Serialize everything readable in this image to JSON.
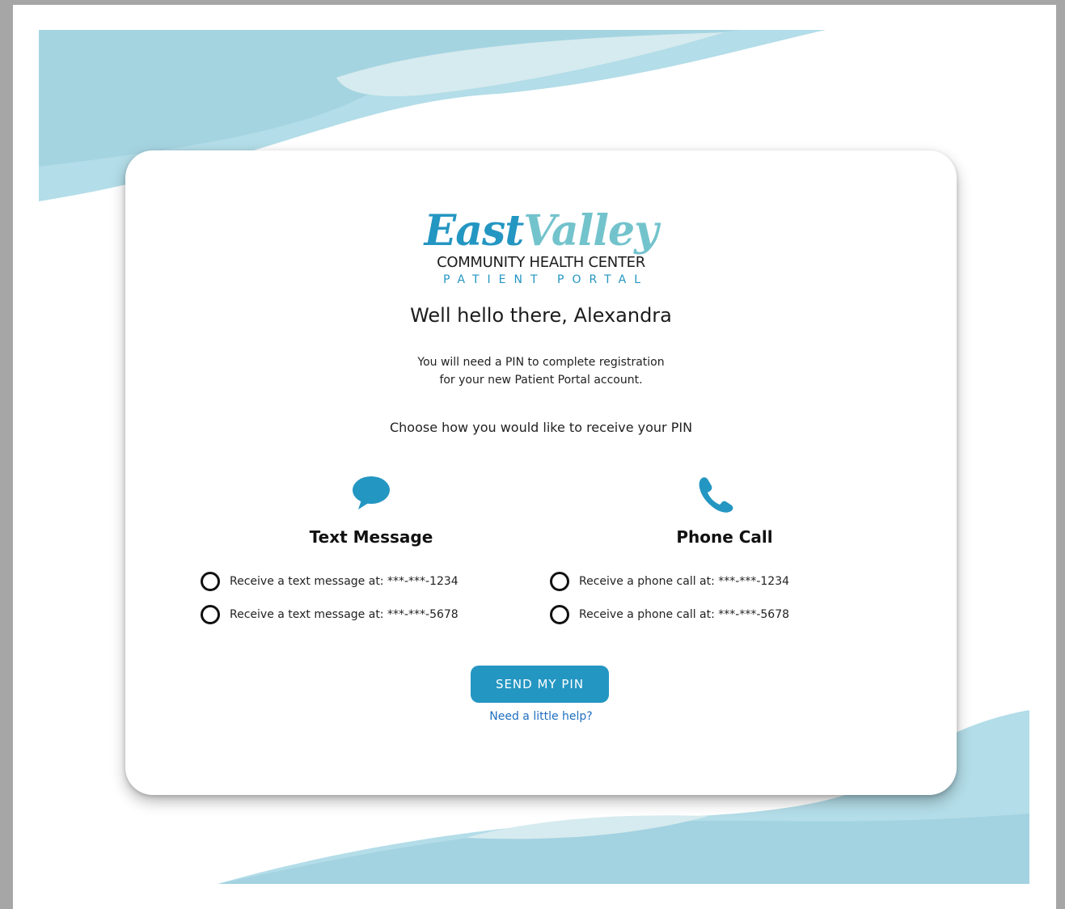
{
  "logo": {
    "brand_part1": "East",
    "brand_part2": "Valley",
    "line2": "COMMUNITY HEALTH CENTER",
    "line3": "PATIENT PORTAL"
  },
  "greeting": "Well hello there, Alexandra",
  "intro": {
    "line1": "You will need a PIN to complete registration",
    "line2": "for your new Patient Portal account."
  },
  "instruction": "Choose how you would like to receive your PIN",
  "options": {
    "text": {
      "title": "Text Message",
      "icon": "speech-bubble-icon",
      "choices": [
        "Receive a text message at: ***-***-1234",
        "Receive a text message at: ***-***-5678"
      ]
    },
    "phone": {
      "title": "Phone Call",
      "icon": "phone-icon",
      "choices": [
        "Receive a phone call at: ***-***-1234",
        "Receive a phone call at: ***-***-5678"
      ]
    }
  },
  "send_button": "SEND MY PIN",
  "help_link": "Need a little help?",
  "colors": {
    "brand_blue": "#2496c2",
    "brand_teal": "#73c3cc",
    "wave_light": "#a7d8e4",
    "link": "#1d6fc0"
  }
}
